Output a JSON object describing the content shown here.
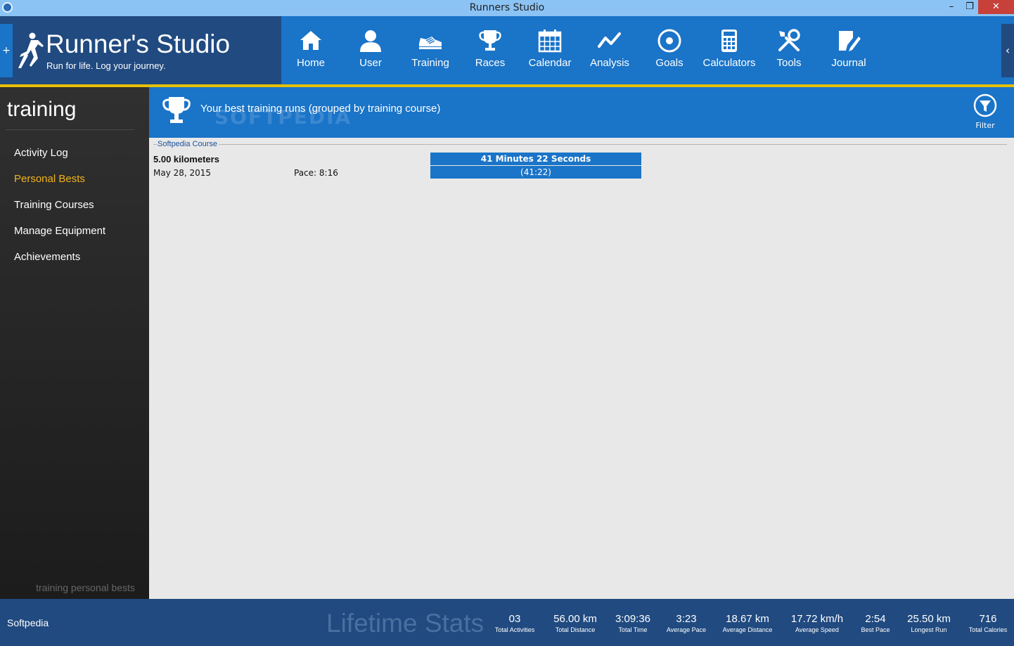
{
  "window": {
    "title": "Runners Studio",
    "minimize": "–",
    "restore": "❐",
    "close": "✕"
  },
  "logo": {
    "title": "Runner's Studio",
    "tagline": "Run for life. Log your journey.",
    "expand_glyph": "+",
    "collapse_glyph": "‹"
  },
  "nav": {
    "items": [
      {
        "label": "Home",
        "icon": "home-icon"
      },
      {
        "label": "User",
        "icon": "user-icon"
      },
      {
        "label": "Training",
        "icon": "shoe-icon"
      },
      {
        "label": "Races",
        "icon": "trophy-icon"
      },
      {
        "label": "Calendar",
        "icon": "calendar-icon"
      },
      {
        "label": "Analysis",
        "icon": "analysis-icon"
      },
      {
        "label": "Goals",
        "icon": "target-icon"
      },
      {
        "label": "Calculators",
        "icon": "calculator-icon"
      },
      {
        "label": "Tools",
        "icon": "tools-icon"
      },
      {
        "label": "Journal",
        "icon": "journal-icon"
      }
    ]
  },
  "sidebar": {
    "title": "training",
    "items": [
      {
        "label": "Activity Log"
      },
      {
        "label": "Personal Bests",
        "active": true
      },
      {
        "label": "Training Courses"
      },
      {
        "label": "Manage Equipment"
      },
      {
        "label": "Achievements"
      }
    ],
    "footer": "training personal bests"
  },
  "content": {
    "heading": "Your best training runs (grouped by training course)",
    "watermark": "SOFTPEDIA",
    "filter_label": "Filter",
    "groups": [
      {
        "course": "Softpedia Course",
        "runs": [
          {
            "distance": "5.00 kilometers",
            "date": "May 28, 2015",
            "pace": "Pace: 8:16",
            "time_text": "41 Minutes 22 Seconds",
            "time_short": "(41:22)"
          }
        ]
      }
    ]
  },
  "status": {
    "brand": "Softpedia",
    "lifetime_label": "Lifetime Stats",
    "stats": [
      {
        "value": "03",
        "caption": "Total Activities"
      },
      {
        "value": "56.00 km",
        "caption": "Total Distance"
      },
      {
        "value": "3:09:36",
        "caption": "Total Time"
      },
      {
        "value": "3:23",
        "caption": "Average Pace"
      },
      {
        "value": "18.67 km",
        "caption": "Average Distance"
      },
      {
        "value": "17.72 km/h",
        "caption": "Average Speed"
      },
      {
        "value": "2:54",
        "caption": "Best Pace"
      },
      {
        "value": "25.50 km",
        "caption": "Longest Run"
      },
      {
        "value": "716",
        "caption": "Total Calories"
      }
    ]
  },
  "colors": {
    "accent": "#1a74c8",
    "dark_blue": "#204a80",
    "highlight": "#f2b31a",
    "yellow_rule": "#e5c000"
  }
}
